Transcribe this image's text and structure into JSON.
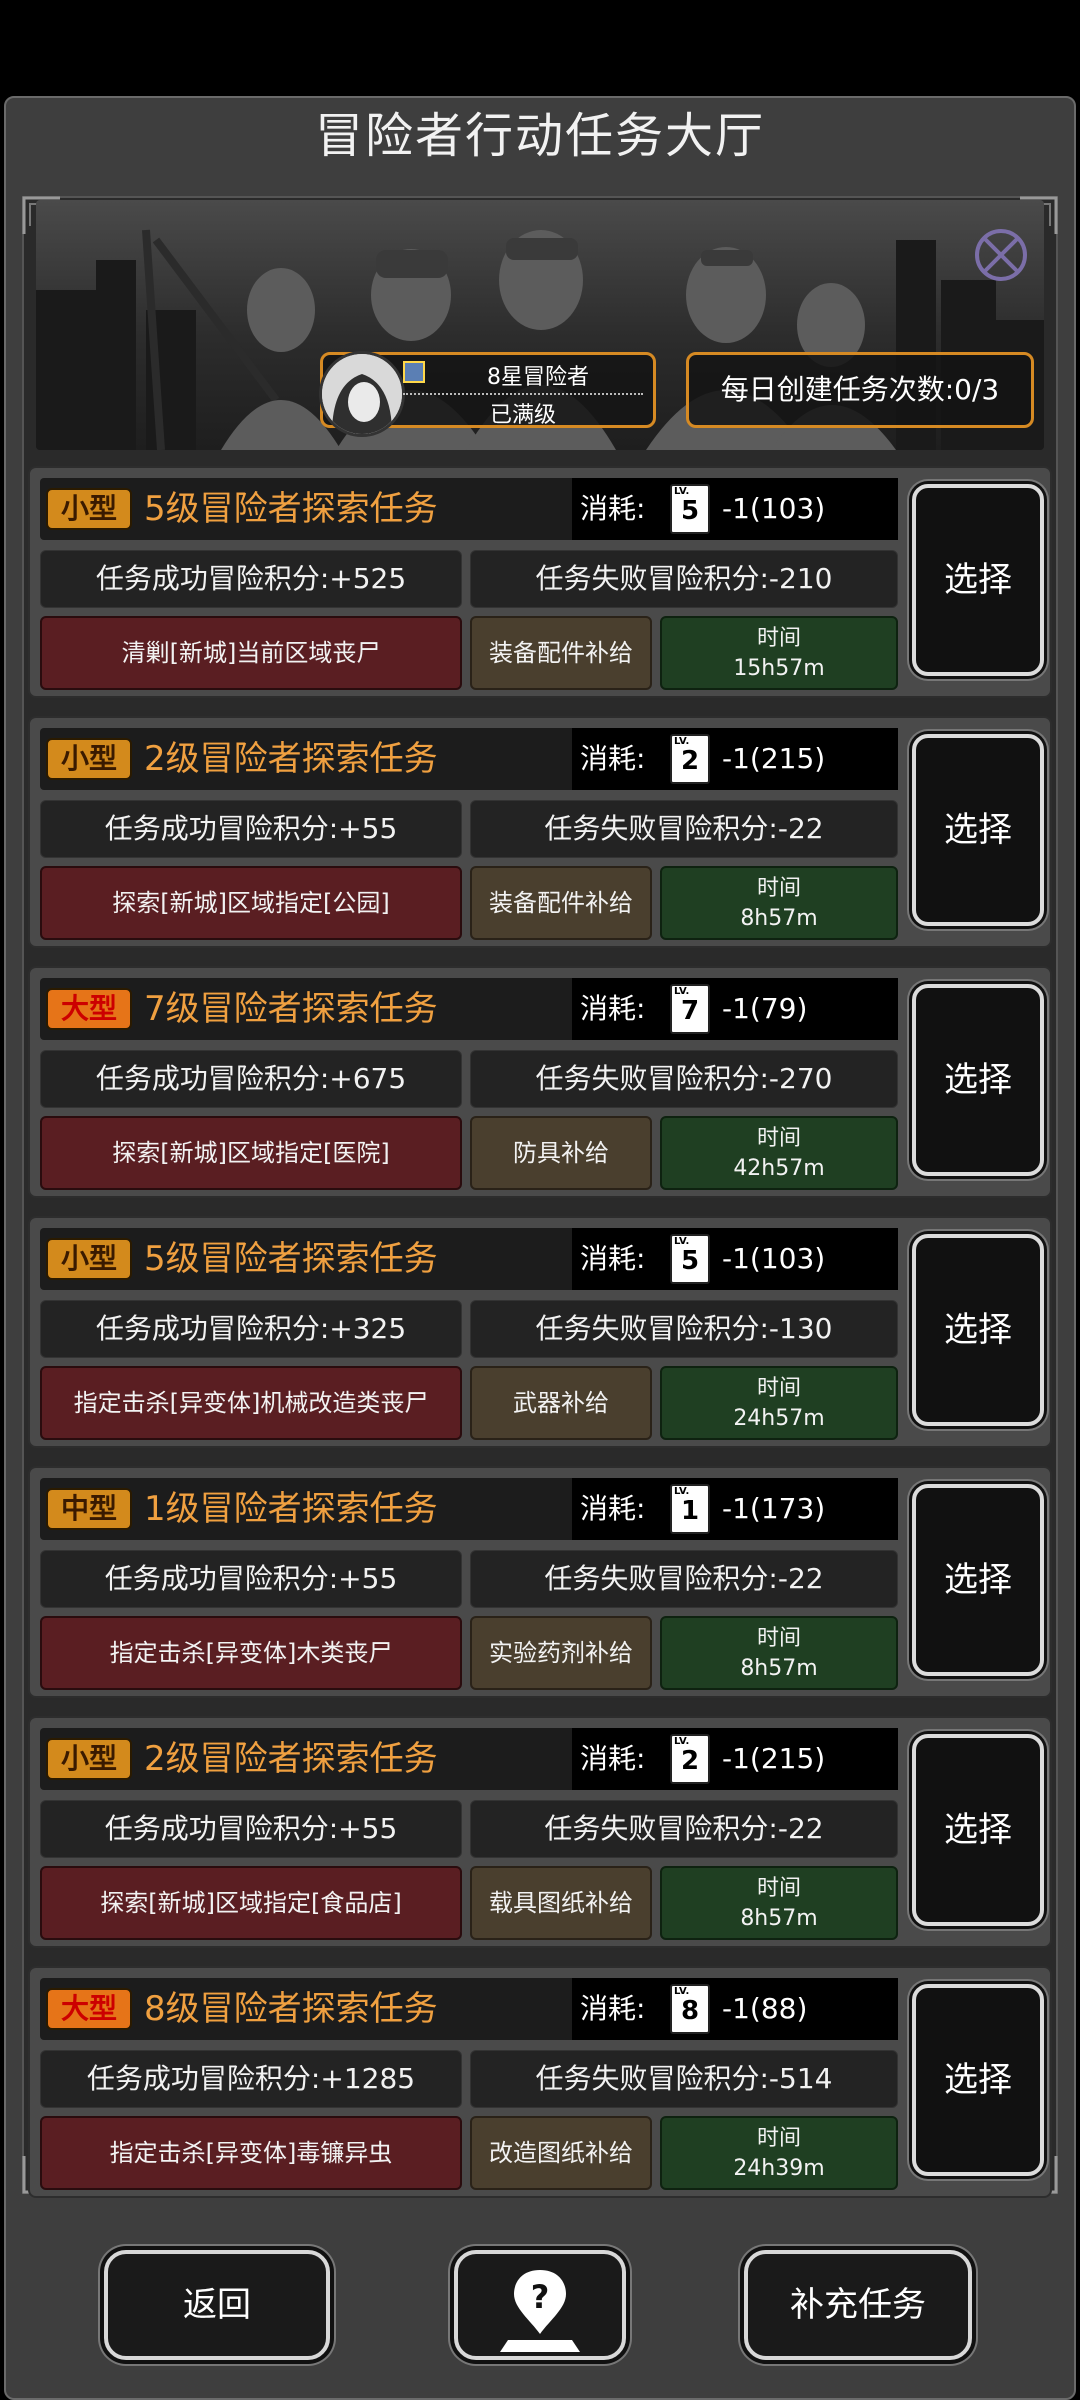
{
  "title": "冒险者行动任务大厅",
  "player": {
    "rank": "8星冒险者",
    "status": "已满级"
  },
  "daily": "每日创建任务次数:0/3",
  "cost_label": "消耗:",
  "select_label": "选择",
  "time_label": "时间",
  "tasks": [
    {
      "size": "小型",
      "name": "5级冒险者探索任务",
      "lv": "5",
      "cost": "-1(103)",
      "success": "任务成功冒险积分:+525",
      "fail": "任务失败冒险积分:-210",
      "objective": "清剿[新城]当前区域丧尸",
      "reward": "装备配件补给",
      "time": "15h57m"
    },
    {
      "size": "小型",
      "name": "2级冒险者探索任务",
      "lv": "2",
      "cost": "-1(215)",
      "success": "任务成功冒险积分:+55",
      "fail": "任务失败冒险积分:-22",
      "objective": "探索[新城]区域指定[公园]",
      "reward": "装备配件补给",
      "time": "8h57m"
    },
    {
      "size": "大型",
      "name": "7级冒险者探索任务",
      "lv": "7",
      "cost": "-1(79)",
      "success": "任务成功冒险积分:+675",
      "fail": "任务失败冒险积分:-270",
      "objective": "探索[新城]区域指定[医院]",
      "reward": "防具补给",
      "time": "42h57m"
    },
    {
      "size": "小型",
      "name": "5级冒险者探索任务",
      "lv": "5",
      "cost": "-1(103)",
      "success": "任务成功冒险积分:+325",
      "fail": "任务失败冒险积分:-130",
      "objective": "指定击杀[异变体]机械改造类丧尸",
      "reward": "武器补给",
      "time": "24h57m"
    },
    {
      "size": "中型",
      "name": "1级冒险者探索任务",
      "lv": "1",
      "cost": "-1(173)",
      "success": "任务成功冒险积分:+55",
      "fail": "任务失败冒险积分:-22",
      "objective": "指定击杀[异变体]木类丧尸",
      "reward": "实验药剂补给",
      "time": "8h57m"
    },
    {
      "size": "小型",
      "name": "2级冒险者探索任务",
      "lv": "2",
      "cost": "-1(215)",
      "success": "任务成功冒险积分:+55",
      "fail": "任务失败冒险积分:-22",
      "objective": "探索[新城]区域指定[食品店]",
      "reward": "载具图纸补给",
      "time": "8h57m"
    },
    {
      "size": "大型",
      "name": "8级冒险者探索任务",
      "lv": "8",
      "cost": "-1(88)",
      "success": "任务成功冒险积分:+1285",
      "fail": "任务失败冒险积分:-514",
      "objective": "指定击杀[异变体]毒镰异虫",
      "reward": "改造图纸补给",
      "time": "24h39m"
    }
  ],
  "bottom": {
    "back": "返回",
    "help_icon": "map-pin-question-icon",
    "refill": "补充任务"
  }
}
